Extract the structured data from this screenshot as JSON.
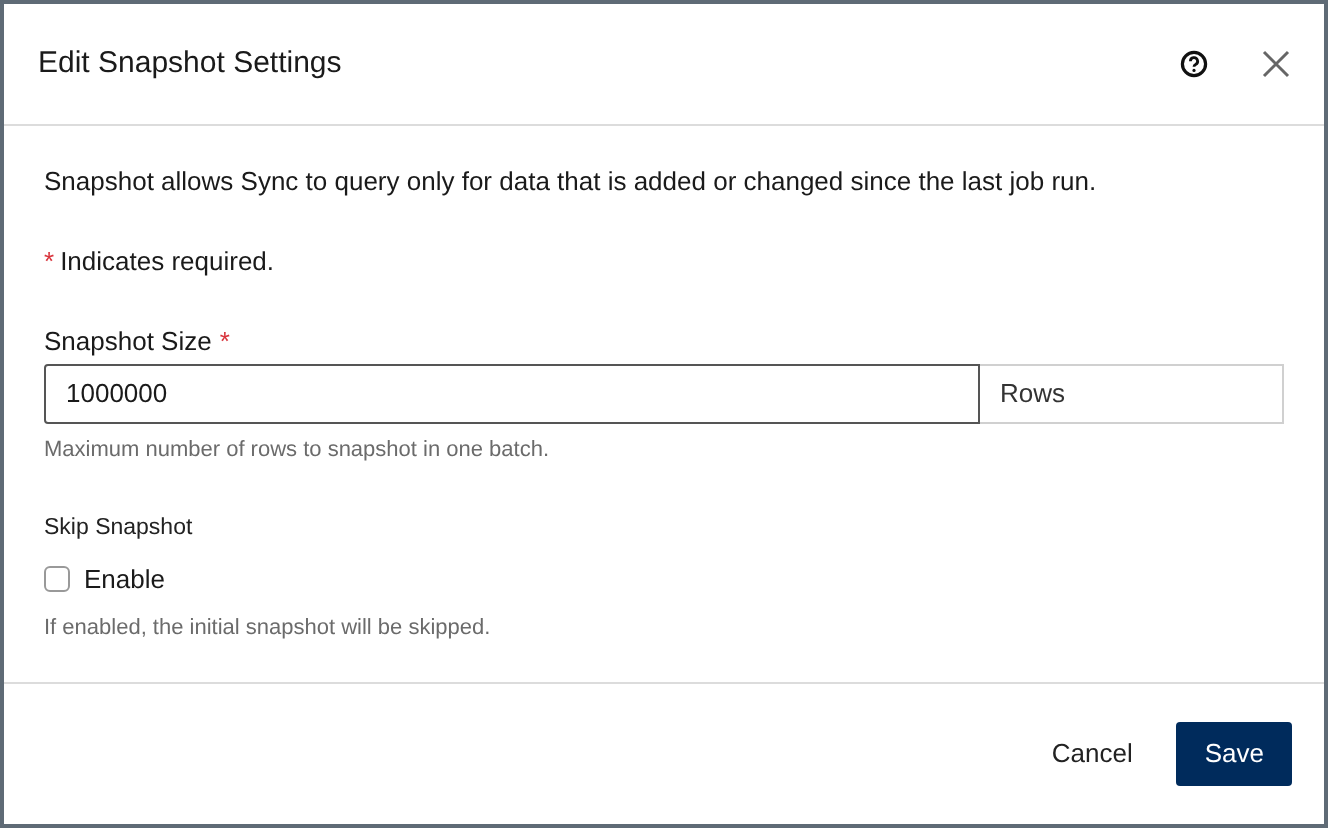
{
  "dialog": {
    "title": "Edit Snapshot Settings"
  },
  "description": "Snapshot allows Sync to query only for data that is added or changed since the last job run.",
  "required_note": {
    "mark": "*",
    "text": "Indicates required."
  },
  "snapshot_size": {
    "label": "Snapshot Size",
    "required_mark": "*",
    "value": "1000000",
    "unit": "Rows",
    "help": "Maximum number of rows to snapshot in one batch."
  },
  "skip_snapshot": {
    "label": "Skip Snapshot",
    "checkbox": {
      "label": "Enable",
      "checked": false
    },
    "help": "If enabled, the initial snapshot will be skipped."
  },
  "buttons": [
    {
      "kind": "secondary",
      "label": "Cancel"
    },
    {
      "kind": "primary",
      "label": "Save"
    }
  ]
}
